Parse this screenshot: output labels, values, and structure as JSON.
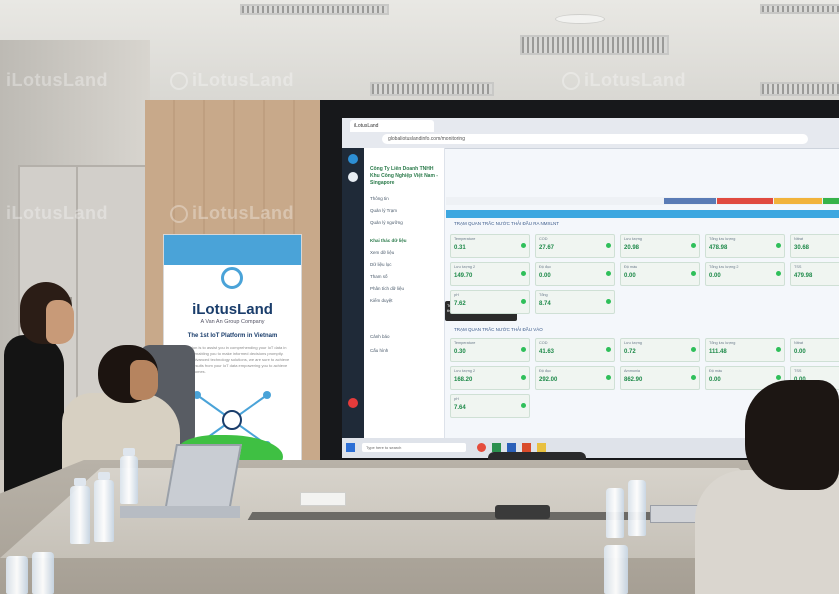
{
  "screen": {
    "tab_label": "iLotusLand",
    "url": "globaliotuslandinfo.com/monitoring",
    "company_name": "Công Ty Liên Doanh TNHH Khu Công Nghiệp Việt Nam - Singapore",
    "sidebar_items": [
      "Thông tin",
      "Quản lý Trạm",
      "Quản lý ngưỡng",
      "Khai thác dữ liệu",
      "Xem dữ liệu",
      "Dữ liệu lọc",
      "Tham số",
      "Phân tích dữ liệu",
      "Kiểm duyệt",
      "Cảnh báo",
      "Cấu hình"
    ],
    "section1_title": "TRẠM QUAN TRẮC NƯỚC THẢI ĐẦU RA NMXLNT",
    "section2_title": "TRẠM QUAN TRẮC NƯỚC THẢI ĐẦU VÀO",
    "cards_row1": [
      {
        "label": "Temperature",
        "value": "0.31"
      },
      {
        "label": "COD",
        "value": "27.67"
      },
      {
        "label": "Lưu lượng",
        "value": "20.98"
      },
      {
        "label": "Tổng lưu lượng",
        "value": "478.98"
      },
      {
        "label": "Nitrat",
        "value": "30.68"
      }
    ],
    "cards_row2": [
      {
        "label": "Lưu lượng 2",
        "value": "149.70"
      },
      {
        "label": "Độ đục",
        "value": "0.00"
      },
      {
        "label": "Độ màu",
        "value": "0.00"
      },
      {
        "label": "Tổng lưu lượng 2",
        "value": "0.00"
      },
      {
        "label": "TSS",
        "value": "479.98"
      }
    ],
    "cards_row3": [
      {
        "label": "pH",
        "value": "7.62"
      },
      {
        "label": "Tổng",
        "value": "8.74"
      }
    ],
    "cards_row4": [
      {
        "label": "Temperature",
        "value": "0.30"
      },
      {
        "label": "COD",
        "value": "41.63"
      },
      {
        "label": "Lưu lượng",
        "value": "0.72"
      },
      {
        "label": "Tổng lưu lượng",
        "value": "111.48"
      },
      {
        "label": "Nitrat",
        "value": "0.00"
      }
    ],
    "cards_row5": [
      {
        "label": "Lưu lượng 2",
        "value": "168.20"
      },
      {
        "label": "Độ đục",
        "value": "292.00"
      },
      {
        "label": "Ammonia",
        "value": "862.90"
      },
      {
        "label": "Độ màu",
        "value": "0.00"
      },
      {
        "label": "TSS",
        "value": "0.00"
      }
    ],
    "cards_row6": [
      {
        "label": "pH",
        "value": "7.64"
      }
    ],
    "tooltip": "Trả dữ liệu cho đầu dữ liệu của vào tháng của số với đặc điểm",
    "taskbar_search": "Type here to search"
  },
  "banner": {
    "logo": "iLotusLand",
    "subtitle": "A Van An Group Company",
    "tagline": "The 1st IoT Platform in Vietnam",
    "body": "Our mission is to assist you in comprehending your IoT data in real-time, enabling you to make informed decisions promptly. With our advanced technology solutions, we are sure to achieve effective results from your IoT data empowering you to achieve better outcomes."
  },
  "watermark": "iLotusLand"
}
